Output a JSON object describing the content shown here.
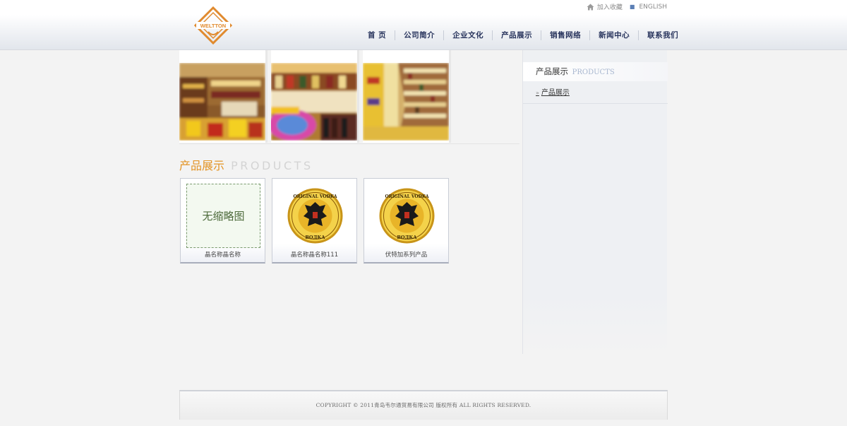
{
  "brand": {
    "logo_text": "WELTTON",
    "accent": "#e08a2e"
  },
  "top_links": {
    "favorite_label": "加入收藏",
    "english_label": "ENGLISH"
  },
  "nav": {
    "items": [
      {
        "label": "首 页"
      },
      {
        "label": "公司简介"
      },
      {
        "label": "企业文化"
      },
      {
        "label": "产品展示"
      },
      {
        "label": "销售网络"
      },
      {
        "label": "新闻中心"
      },
      {
        "label": "联系我们"
      }
    ]
  },
  "main": {
    "section_title_cn": "产品展示",
    "section_title_en": "PRODUCTS",
    "products": [
      {
        "name": "晶名称晶名称",
        "thumbnail": "无缩略图",
        "image": "no-thumbnail"
      },
      {
        "name": "晶名称晶名称111",
        "image": "vodka-seal"
      },
      {
        "name": "伏特加系列产品",
        "image": "vodka-seal"
      }
    ]
  },
  "sidebar": {
    "title_cn": "产品展示",
    "title_en": "PRODUCTS",
    "items": [
      {
        "label": "产品展示"
      }
    ]
  },
  "footer": {
    "copyright": "COPYRIGHT © 2011青岛韦尔通贸易有限公司 版权所有 ALL RIGHTS RESERVED."
  },
  "colors": {
    "nav_text": "#27335c",
    "title_orange": "#e39426",
    "title_en_gray": "#d4d4d4",
    "background": "#f3f3f3"
  }
}
